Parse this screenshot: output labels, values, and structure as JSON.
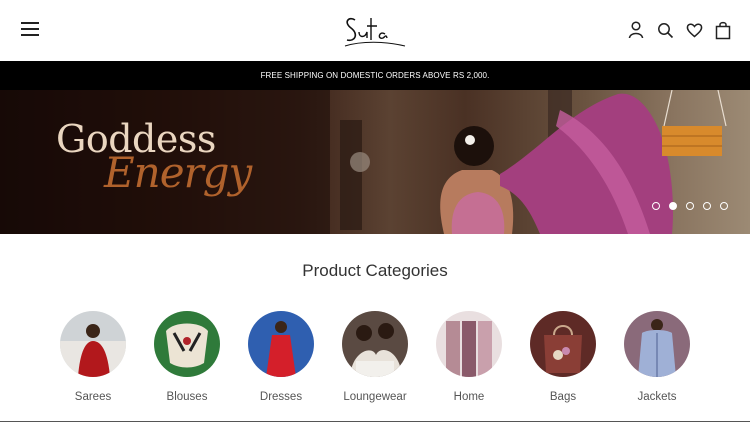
{
  "header": {
    "menu_icon": "hamburger-icon",
    "logo_text": "Suta",
    "icons": [
      "account-icon",
      "search-icon",
      "wishlist-heart-icon",
      "cart-bag-icon"
    ]
  },
  "announcement": {
    "text": "FREE SHIPPING ON DOMESTIC ORDERS ABOVE RS 2,000."
  },
  "hero": {
    "line1": "Goddess",
    "line2": "Energy",
    "slides": 5,
    "active_slide": 2
  },
  "categories": {
    "title": "Product Categories",
    "items": [
      {
        "label": "Sarees"
      },
      {
        "label": "Blouses"
      },
      {
        "label": "Dresses"
      },
      {
        "label": "Loungewear"
      },
      {
        "label": "Home"
      },
      {
        "label": "Bags"
      },
      {
        "label": "Jackets"
      }
    ]
  },
  "colors": {
    "announcement_bg": "#000000",
    "hero_accent": "#b0622c",
    "hero_text": "#ead6c0"
  }
}
